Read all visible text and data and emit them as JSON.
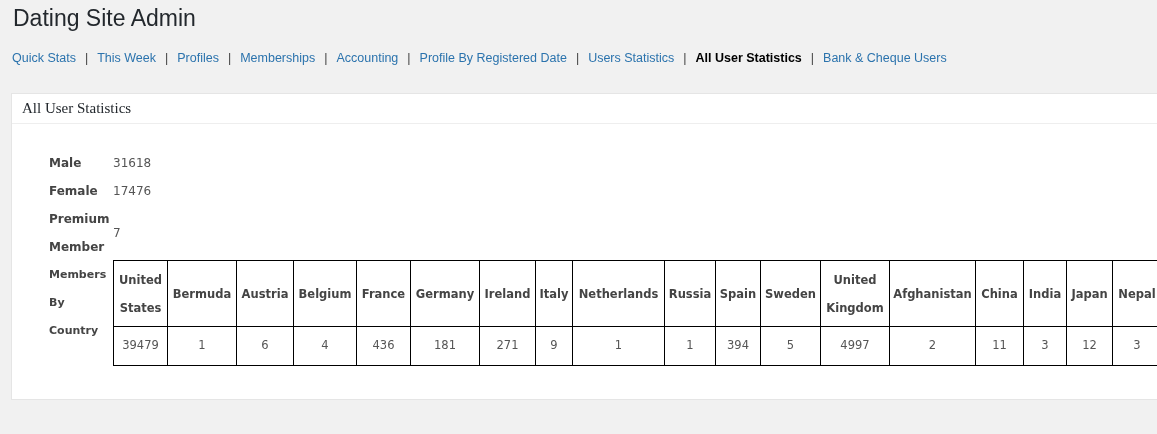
{
  "page_title": "Dating Site Admin",
  "nav": [
    {
      "label": "Quick Stats",
      "selected": false,
      "separator": "|"
    },
    {
      "label": "This Week",
      "selected": false,
      "separator": "|"
    },
    {
      "label": "Profiles",
      "selected": false,
      "separator": "|"
    },
    {
      "label": "Memberships",
      "selected": false,
      "separator": "|"
    },
    {
      "label": "Accounting",
      "selected": false,
      "separator": "|"
    },
    {
      "label": "Profile By Registered Date",
      "selected": false,
      "separator": "|"
    },
    {
      "label": "Users Statistics",
      "selected": false,
      "separator": "|"
    },
    {
      "label": "All User Statistics",
      "selected": true,
      "separator": "|"
    },
    {
      "label": "Bank & Cheque Users",
      "selected": false
    }
  ],
  "panel": {
    "title": "All User Statistics",
    "stats": [
      {
        "label": "Male",
        "value": "31618"
      },
      {
        "label": "Female",
        "value": "17476"
      },
      {
        "label": "Premium Member",
        "value": "7"
      }
    ],
    "by_country": {
      "label": "Members By Country",
      "columns": [
        "United States",
        "Bermuda",
        "Austria",
        "Belgium",
        "France",
        "Germany",
        "Ireland",
        "Italy",
        "Netherlands",
        "Russia",
        "Spain",
        "Sweden",
        "United Kingdom",
        "Afghanistan",
        "China",
        "India",
        "Japan",
        "Nepal"
      ],
      "values": [
        "39479",
        "1",
        "6",
        "4",
        "436",
        "181",
        "271",
        "9",
        "1",
        "1",
        "394",
        "5",
        "4997",
        "2",
        "11",
        "3",
        "12",
        "3"
      ]
    }
  }
}
